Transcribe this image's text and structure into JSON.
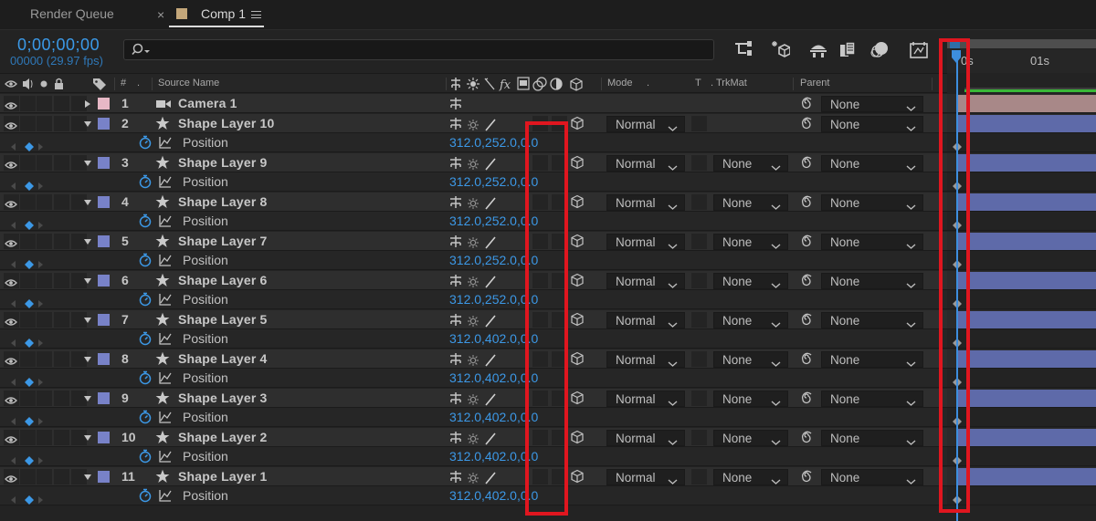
{
  "tabs": {
    "render_queue": "Render Queue",
    "close": "×",
    "comp": "Comp 1"
  },
  "time": {
    "timecode": "0;00;00;00",
    "frames_fps": "00000 (29.97 fps)"
  },
  "timeline": {
    "ruler_labels": [
      "0s",
      "01s"
    ]
  },
  "headers": {
    "hash": "#",
    "source_name": "Source Name",
    "mode": "Mode",
    "t": "T",
    "trkmat": "TrkMat",
    "parent": "Parent"
  },
  "layers": [
    {
      "num": "1",
      "name": "Camera 1",
      "type": "camera",
      "label_color": "#e7b8c6",
      "mode": "",
      "trkmat": "",
      "parent": "None",
      "property": null
    },
    {
      "num": "2",
      "name": "Shape Layer 10",
      "type": "shape",
      "label_color": "#7882c8",
      "mode": "Normal",
      "trkmat": "",
      "parent": "None",
      "property": {
        "name": "Position",
        "value": "312.0,252.0,0.0"
      }
    },
    {
      "num": "3",
      "name": "Shape Layer 9",
      "type": "shape",
      "label_color": "#7882c8",
      "mode": "Normal",
      "trkmat": "None",
      "parent": "None",
      "property": {
        "name": "Position",
        "value": "312.0,252.0,0.0"
      }
    },
    {
      "num": "4",
      "name": "Shape Layer 8",
      "type": "shape",
      "label_color": "#7882c8",
      "mode": "Normal",
      "trkmat": "None",
      "parent": "None",
      "property": {
        "name": "Position",
        "value": "312.0,252.0,0.0"
      }
    },
    {
      "num": "5",
      "name": "Shape Layer 7",
      "type": "shape",
      "label_color": "#7882c8",
      "mode": "Normal",
      "trkmat": "None",
      "parent": "None",
      "property": {
        "name": "Position",
        "value": "312.0,252.0,0.0"
      }
    },
    {
      "num": "6",
      "name": "Shape Layer 6",
      "type": "shape",
      "label_color": "#7882c8",
      "mode": "Normal",
      "trkmat": "None",
      "parent": "None",
      "property": {
        "name": "Position",
        "value": "312.0,252.0,0.0"
      }
    },
    {
      "num": "7",
      "name": "Shape Layer 5",
      "type": "shape",
      "label_color": "#7882c8",
      "mode": "Normal",
      "trkmat": "None",
      "parent": "None",
      "property": {
        "name": "Position",
        "value": "312.0,402.0,0.0"
      }
    },
    {
      "num": "8",
      "name": "Shape Layer 4",
      "type": "shape",
      "label_color": "#7882c8",
      "mode": "Normal",
      "trkmat": "None",
      "parent": "None",
      "property": {
        "name": "Position",
        "value": "312.0,402.0,0.0"
      }
    },
    {
      "num": "9",
      "name": "Shape Layer 3",
      "type": "shape",
      "label_color": "#7882c8",
      "mode": "Normal",
      "trkmat": "None",
      "parent": "None",
      "property": {
        "name": "Position",
        "value": "312.0,402.0,0.0"
      }
    },
    {
      "num": "10",
      "name": "Shape Layer 2",
      "type": "shape",
      "label_color": "#7882c8",
      "mode": "Normal",
      "trkmat": "None",
      "parent": "None",
      "property": {
        "name": "Position",
        "value": "312.0,402.0,0.0"
      }
    },
    {
      "num": "11",
      "name": "Shape Layer 1",
      "type": "shape",
      "label_color": "#7882c8",
      "mode": "Normal",
      "trkmat": "None",
      "parent": "None",
      "property": {
        "name": "Position",
        "value": "312.0,402.0,0.0"
      }
    }
  ],
  "colors": {
    "accent_blue": "#3c98e6",
    "highlight_red": "#e0161f",
    "work_area_green": "#39b837"
  }
}
